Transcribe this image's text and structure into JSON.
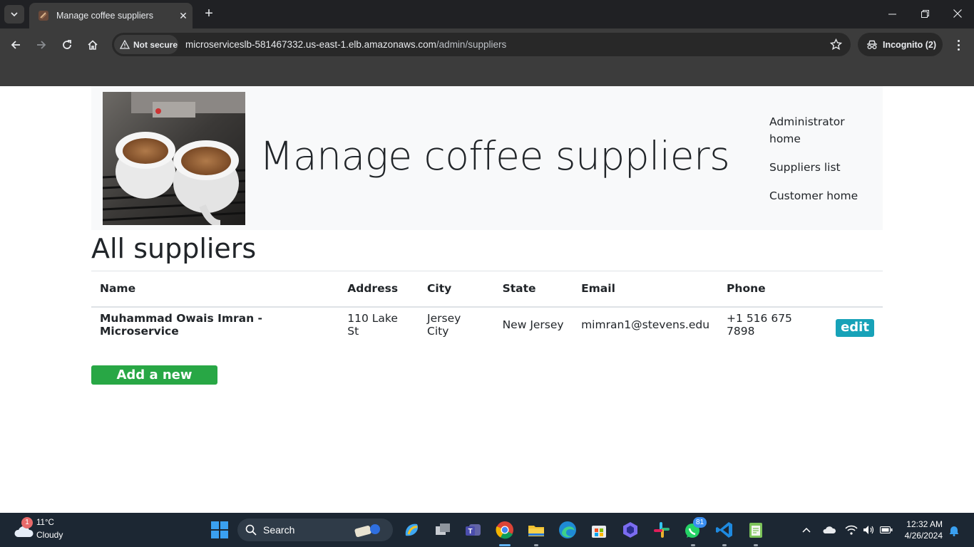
{
  "browser": {
    "tab_title": "Manage coffee suppliers",
    "security_label": "Not secure",
    "url_host": "microserviceslb-581467332.us-east-1.elb.amazonaws.com",
    "url_path": "/admin/suppliers",
    "incognito_label": "Incognito (2)"
  },
  "header": {
    "title": "Manage coffee suppliers",
    "nav": [
      {
        "label": "Administrator home"
      },
      {
        "label": "Suppliers list"
      },
      {
        "label": "Customer home"
      }
    ]
  },
  "main": {
    "section_title": "All suppliers",
    "columns": [
      "Name",
      "Address",
      "City",
      "State",
      "Email",
      "Phone"
    ],
    "rows": [
      {
        "name": "Muhammad Owais Imran - Microservice",
        "address": "110 Lake St",
        "city": "Jersey City",
        "state": "New Jersey",
        "email": "mimran1@stevens.edu",
        "phone": "+1 516 675 7898",
        "action": "edit"
      }
    ],
    "add_button": "Add a new supplier"
  },
  "colors": {
    "edit_button": "#17a2b8",
    "add_button": "#28a745",
    "header_bg": "#f8f9fa"
  },
  "taskbar": {
    "weather_temp": "11°C",
    "weather_desc": "Cloudy",
    "weather_badge": "1",
    "search_placeholder": "Search",
    "whatsapp_badge": "81",
    "time": "12:32 AM",
    "date": "4/26/2024"
  }
}
